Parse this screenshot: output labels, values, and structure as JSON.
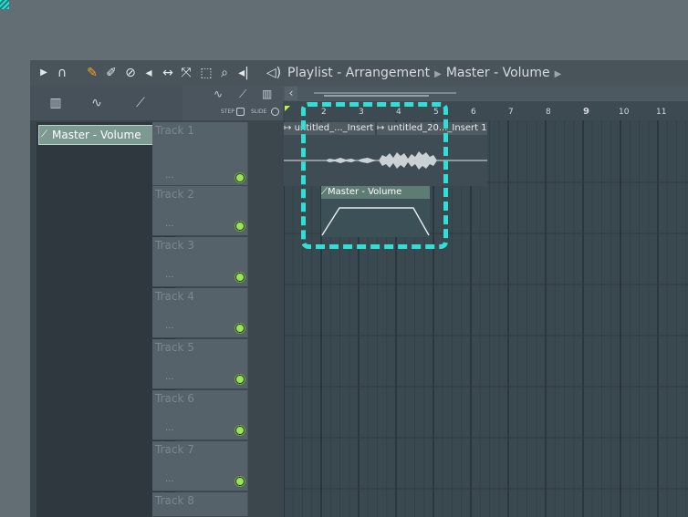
{
  "toolbar": {
    "icons": [
      "play-menu-icon",
      "magnet-icon",
      "pencil-icon",
      "paint-icon",
      "delete-icon",
      "mute-icon",
      "slip-icon",
      "slice-icon",
      "select-icon",
      "zoom-icon",
      "playback-icon",
      "speaker-icon"
    ],
    "breadcrumb": [
      "Playlist - Arrangement",
      "Master - Volume"
    ]
  },
  "left_panel": {
    "tabs": [
      "piano-roll-icon",
      "audio-icon",
      "automation-icon"
    ],
    "items": [
      {
        "label": "Master - Volume",
        "icon": "automation-icon"
      }
    ]
  },
  "tracks_header": {
    "step_label": "STEP",
    "slide_label": "SLIDE"
  },
  "tracks": [
    {
      "name": "Track 1",
      "dots": "..."
    },
    {
      "name": "Track 2",
      "dots": "..."
    },
    {
      "name": "Track 3",
      "dots": "..."
    },
    {
      "name": "Track 4",
      "dots": "..."
    },
    {
      "name": "Track 5",
      "dots": "..."
    },
    {
      "name": "Track 6",
      "dots": "..."
    },
    {
      "name": "Track 7",
      "dots": "..."
    },
    {
      "name": "Track 8",
      "dots": "..."
    }
  ],
  "ruler": {
    "bars": [
      "1",
      "2",
      "3",
      "4",
      "5",
      "6",
      "7",
      "8",
      "9",
      "10",
      "11"
    ]
  },
  "clips": [
    {
      "label": "untitled_..._Insert 1",
      "type": "audio"
    },
    {
      "label": "untitled_20..._Insert 1",
      "type": "audio"
    },
    {
      "label": "Master - Volume",
      "type": "automation"
    }
  ],
  "colors": {
    "accent": "#2ee0d6",
    "selected_item": "#7d9a92",
    "led": "#9be35a"
  }
}
